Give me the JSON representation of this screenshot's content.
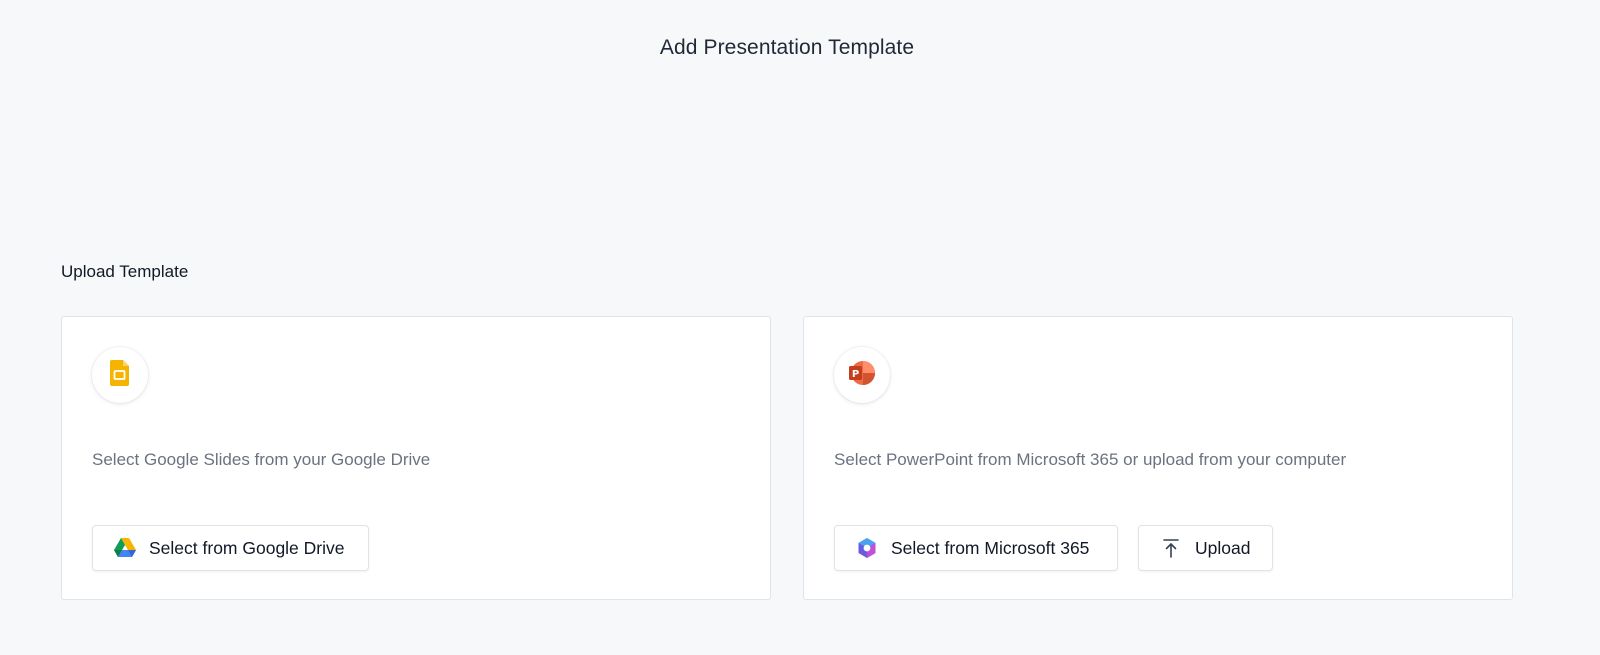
{
  "header": {
    "title": "Add Presentation Template"
  },
  "section": {
    "title": "Upload Template"
  },
  "cards": {
    "google": {
      "logo_icon": "google-slides-icon",
      "description": "Select Google Slides from your Google Drive",
      "button_label": "Select from Google Drive",
      "button_icon": "google-drive-icon"
    },
    "microsoft": {
      "logo_icon": "powerpoint-icon",
      "description": "Select PowerPoint from Microsoft 365 or upload from your computer",
      "button_label": "Select from Microsoft 365",
      "button_icon": "microsoft-365-icon",
      "upload_label": "Upload",
      "upload_icon": "upload-icon"
    }
  },
  "colors": {
    "background": "#f7f8fa",
    "card_border": "#dfe3ea",
    "muted_text": "#6b7280",
    "google_slides_yellow": "#f4b400",
    "powerpoint_orange": "#d24726"
  }
}
